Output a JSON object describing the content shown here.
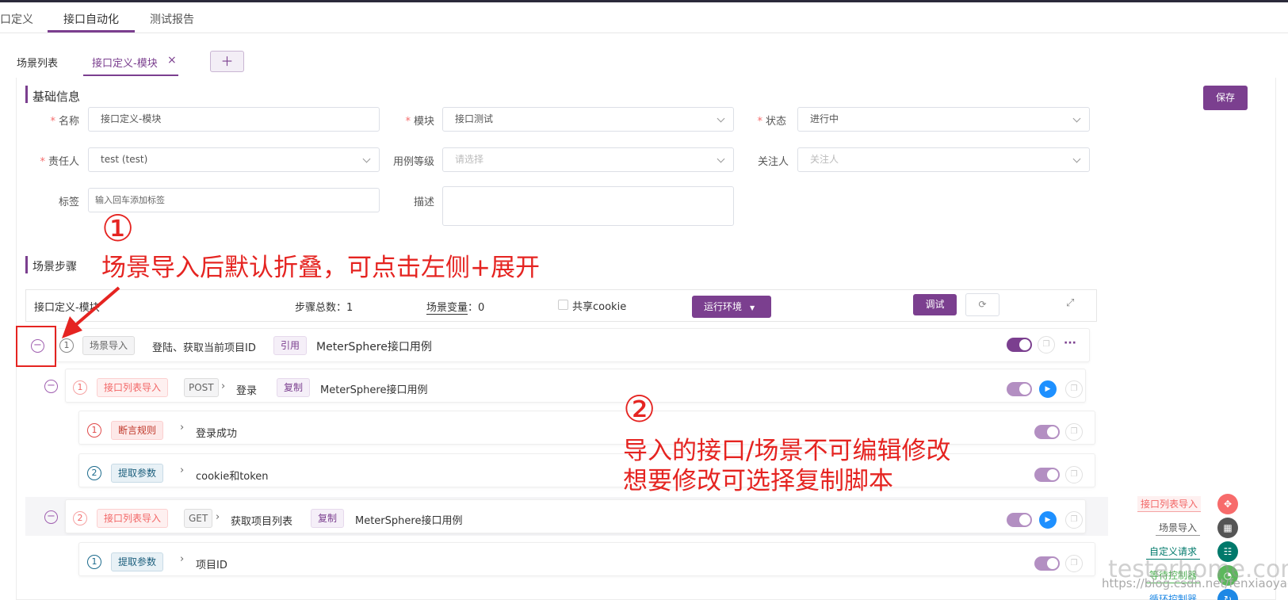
{
  "nav": {
    "tabs": [
      "口定义",
      "接口自动化",
      "测试报告"
    ]
  },
  "subtabs": {
    "list": "场景列表",
    "active": "接口定义-模块",
    "close": "×",
    "add": "＋"
  },
  "basic": {
    "title": "基础信息",
    "save": "保存",
    "name_label": "名称",
    "name_value": "接口定义-模块",
    "module_label": "模块",
    "module_value": "接口测试",
    "status_label": "状态",
    "status_value": "进行中",
    "owner_label": "责任人",
    "owner_value": "test (test)",
    "level_label": "用例等级",
    "level_placeholder": "请选择",
    "follower_label": "关注人",
    "follower_placeholder": "关注人",
    "tags_label": "标签",
    "tags_placeholder": "输入回车添加标签",
    "desc_label": "描述",
    "required_mark": "*"
  },
  "steps": {
    "title": "场景步骤",
    "scenario_name": "接口定义-模块",
    "total_label": "步骤总数：",
    "total_value": "1",
    "vars_label": "场景变量",
    "vars_value": "：0",
    "cookie_label": "共享cookie",
    "env_button": "运行环境",
    "debug_button": "调试"
  },
  "rows": [
    {
      "num": "1",
      "type": "场景导入",
      "name": "登陆、获取当前项目ID",
      "ref": "引用",
      "project": "MeterSphere接口用例"
    },
    {
      "num": "1",
      "type": "接口列表导入",
      "method": "POST",
      "name": "登录",
      "ref": "复制",
      "project": "MeterSphere接口用例"
    },
    {
      "num": "1",
      "type": "断言规则",
      "name": "登录成功"
    },
    {
      "num": "2",
      "type": "提取参数",
      "name": "cookie和token"
    },
    {
      "num": "2",
      "type": "接口列表导入",
      "method": "GET",
      "name": "获取项目列表",
      "ref": "复制",
      "project": "MeterSphere接口用例"
    },
    {
      "num": "1",
      "type": "提取参数",
      "name": "项目ID"
    }
  ],
  "annotations": {
    "one_mark": "①",
    "one_text": "场景导入后默认折叠，可点击左侧+展开",
    "two_mark": "②",
    "two_line1": "导入的接口/场景不可编辑修改",
    "two_line2": "想要修改可选择复制脚本"
  },
  "fabs": [
    "接口列表导入",
    "场景导入",
    "自定义请求",
    "等待控制器",
    "循环控制器"
  ],
  "watermark": {
    "logo": "testerhome.com",
    "url": "https://blog.csdn.net/fenxiaoyao"
  },
  "colors": {
    "brand": "#7b3f8f",
    "annotation": "#e52421",
    "run": "#1e90ff"
  }
}
